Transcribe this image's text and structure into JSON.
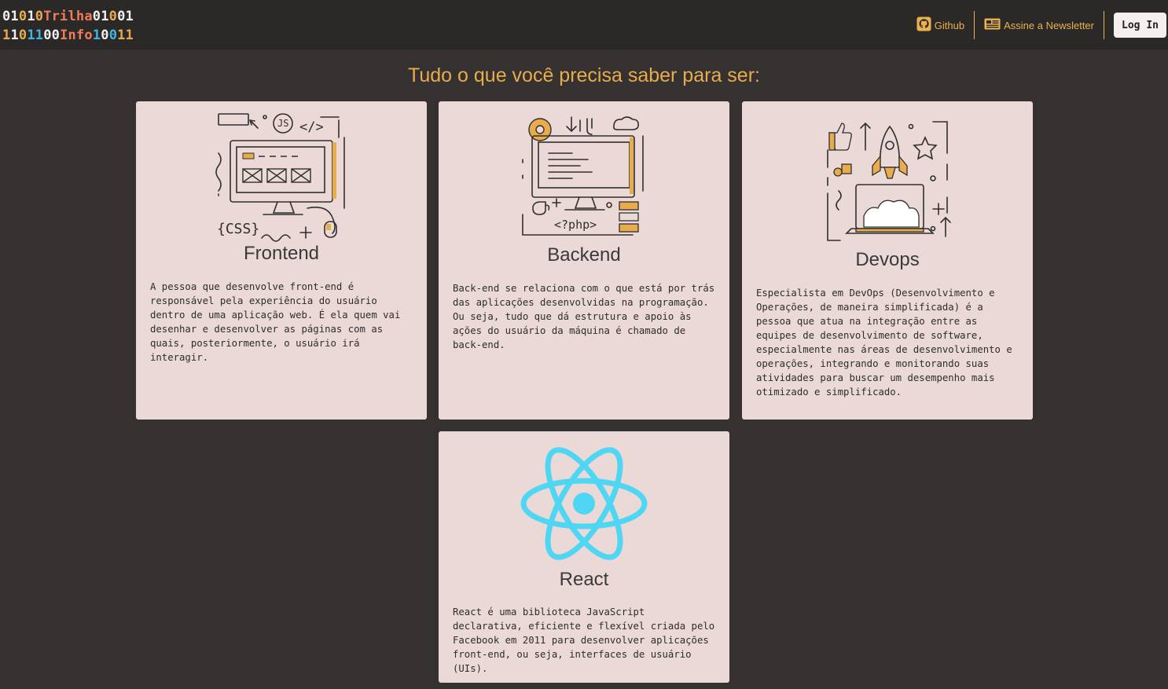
{
  "header": {
    "logo": {
      "line1": [
        {
          "t": "01",
          "c": "#f0f0f0"
        },
        {
          "t": "0",
          "c": "#e9ac4d"
        },
        {
          "t": "1",
          "c": "#f0f0f0"
        },
        {
          "t": "0",
          "c": "#e9ac4d"
        },
        {
          "t": "Trilha",
          "c": "#f07b5a"
        },
        {
          "t": "01",
          "c": "#f0f0f0"
        },
        {
          "t": "0",
          "c": "#e9ac4d"
        },
        {
          "t": "01",
          "c": "#f0f0f0"
        }
      ],
      "line2": [
        {
          "t": "1",
          "c": "#e9ac4d"
        },
        {
          "t": "1",
          "c": "#f0f0f0"
        },
        {
          "t": "0",
          "c": "#e9ac4d"
        },
        {
          "t": "11",
          "c": "#3fb6e0"
        },
        {
          "t": "00",
          "c": "#f0f0f0"
        },
        {
          "t": "Info",
          "c": "#f07b5a"
        },
        {
          "t": "1",
          "c": "#3fb6e0"
        },
        {
          "t": "0",
          "c": "#f0f0f0"
        },
        {
          "t": "0",
          "c": "#3fb6e0"
        },
        {
          "t": "11",
          "c": "#e9ac4d"
        }
      ]
    },
    "nav": {
      "github_label": "Github",
      "newsletter_label": "Assine a Newsletter",
      "login_label": "Log In"
    }
  },
  "headline": "Tudo o que você precisa saber para ser:",
  "cards": [
    {
      "title": "Frontend",
      "text": "A pessoa que desenvolve front-end é responsável pela experiência do usuário dentro de uma aplicação web. É ela quem vai desenhar e desenvolver as páginas com as quais, posteriormente, o usuário irá interagir.",
      "art_labels": {
        "js": "JS",
        "code": "</>",
        "css": "{CSS}"
      }
    },
    {
      "title": "Backend",
      "text": "Back-end se relaciona com o que está por trás das aplicações desenvolvidas na programação. Ou seja, tudo que dá estrutura e apoio às ações do usuário da máquina é chamado de back-end.",
      "art_labels": {
        "php": "<?php>"
      }
    },
    {
      "title": "Devops",
      "text": "Especialista em DevOps (Desenvolvimento e Operações, de maneira simplificada) é a pessoa que atua na integração entre as equipes de desenvolvimento de software, especialmente nas áreas de desenvolvimento e operações, integrando e monitorando suas atividades para buscar um desempenho mais otimizado e simplificado."
    },
    {
      "title": "React",
      "text": "React é uma biblioteca JavaScript declarativa, eficiente e flexível criada pelo Facebook em 2011 para desenvolver aplicações front-end, ou seja, interfaces de usuário (UIs)."
    }
  ],
  "colors": {
    "accent": "#e9ac4d",
    "card_bg": "#ead9d6",
    "page_bg": "#353130",
    "react": "#4fd6f3"
  }
}
